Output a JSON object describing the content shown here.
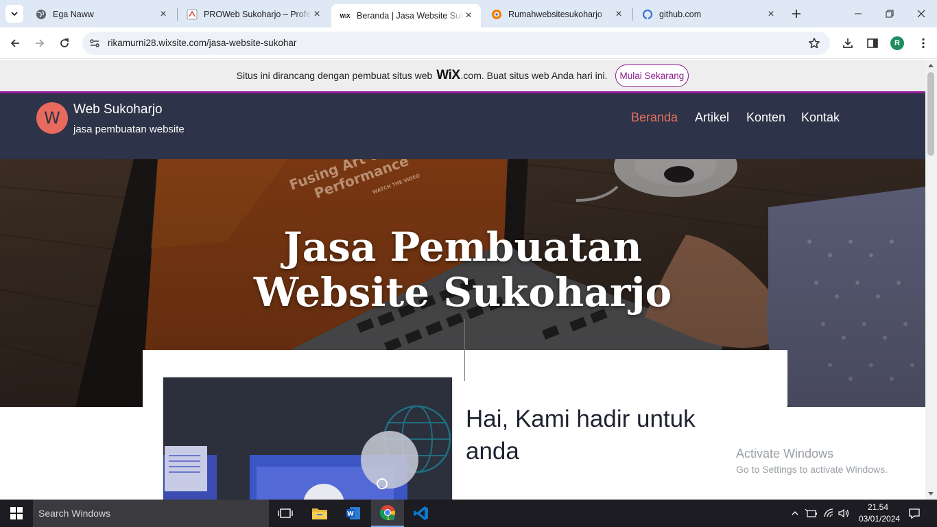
{
  "browser": {
    "tabs": [
      {
        "title": "Ega Naww",
        "favicon": "globe-icon",
        "active": false
      },
      {
        "title": "PROWeb Sukoharjo – Profesional",
        "favicon": "site-icon",
        "active": false
      },
      {
        "title": "Beranda | Jasa Website Sukoharjo",
        "favicon": "wix-icon",
        "favicon_text": "WiX",
        "active": true
      },
      {
        "title": "Rumahwebsitesukoharjo",
        "favicon": "blogger-icon",
        "active": false
      },
      {
        "title": "github.com",
        "favicon": "github-icon",
        "active": false
      }
    ],
    "url": "rikamurni28.wixsite.com/jasa-website-sukohar",
    "profile_initial": "R"
  },
  "wix_banner": {
    "text_before": "Situs ini dirancang dengan pembuat situs web",
    "logo": "WiX",
    "text_after": ".com. Buat situs web Anda hari ini.",
    "cta": "Mulai Sekarang",
    "accent": "#8a1b8d"
  },
  "site": {
    "logo_letter": "W",
    "name": "Web Sukoharjo",
    "tagline": "jasa pembuatan website",
    "menu": [
      {
        "label": "Beranda",
        "active": true
      },
      {
        "label": "Artikel",
        "active": false
      },
      {
        "label": "Konten",
        "active": false
      },
      {
        "label": "Kontak",
        "active": false
      }
    ],
    "header_bg": "#2d3348",
    "accent": "#e8705f"
  },
  "hero": {
    "title_line1": "Jasa Pembuatan",
    "title_line2": "Website Sukoharjo",
    "screen_text_line1": "Fusing Art &",
    "screen_text_line2": "Performance",
    "screen_button": "WATCH THE VIDEO"
  },
  "content": {
    "heading": "Hai, Kami hadir untuk anda"
  },
  "windows_watermark": {
    "line1": "Activate Windows",
    "line2": "Go to Settings to activate Windows."
  },
  "taskbar": {
    "search_placeholder": "Search Windows",
    "apps": [
      "task-view-icon",
      "file-explorer-icon",
      "word-icon",
      "chrome-icon",
      "vscode-icon"
    ],
    "word_letter": "W",
    "time": "21.54",
    "date": "03/01/2024"
  }
}
